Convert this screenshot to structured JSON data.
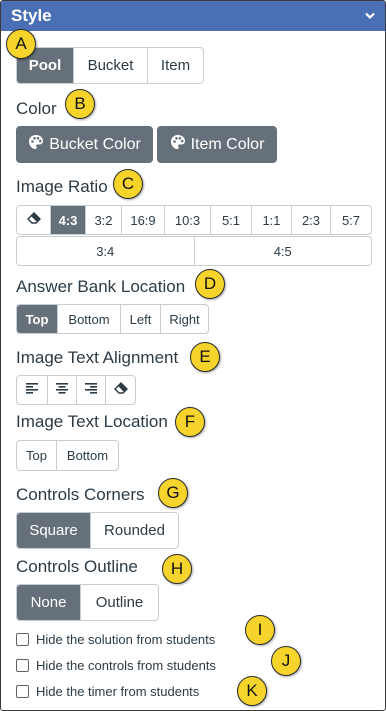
{
  "panel": {
    "title": "Style",
    "chevron_icon": "chevron-down-icon",
    "header_color": "#4a6fb5"
  },
  "type_group": {
    "options": [
      "Pool",
      "Bucket",
      "Item"
    ],
    "selected": "Pool"
  },
  "color": {
    "label": "Color",
    "bucket_button": "Bucket Color",
    "item_button": "Item Color",
    "button_icon": "palette-icon"
  },
  "image_ratio": {
    "label": "Image Ratio",
    "clear_icon": "eraser-icon",
    "row1": [
      "4:3",
      "3:2",
      "16:9",
      "10:3",
      "5:1",
      "1:1",
      "2:3",
      "5:7"
    ],
    "row2": [
      "3:4",
      "4:5"
    ],
    "selected": "4:3"
  },
  "answer_bank_location": {
    "label": "Answer Bank Location",
    "options": [
      "Top",
      "Bottom",
      "Left",
      "Right"
    ],
    "selected": "Top"
  },
  "image_text_alignment": {
    "label": "Image Text Alignment",
    "icons": [
      "align-left-icon",
      "align-center-icon",
      "align-right-icon",
      "eraser-icon"
    ]
  },
  "image_text_location": {
    "label": "Image Text Location",
    "options": [
      "Top",
      "Bottom"
    ],
    "selected": ""
  },
  "controls_corners": {
    "label": "Controls Corners",
    "options": [
      "Square",
      "Rounded"
    ],
    "selected": "Square"
  },
  "controls_outline": {
    "label": "Controls Outline",
    "options": [
      "None",
      "Outline"
    ],
    "selected": "None"
  },
  "checkboxes": [
    {
      "label": "Hide the solution from students",
      "checked": false
    },
    {
      "label": "Hide the controls from students",
      "checked": false
    },
    {
      "label": "Hide the timer from students",
      "checked": false
    }
  ],
  "annotations": [
    "A",
    "B",
    "C",
    "D",
    "E",
    "F",
    "G",
    "H",
    "I",
    "J",
    "K"
  ],
  "colors": {
    "active_button": "#66707a",
    "badge": "#f6d42b",
    "border": "#c7cdd1"
  }
}
